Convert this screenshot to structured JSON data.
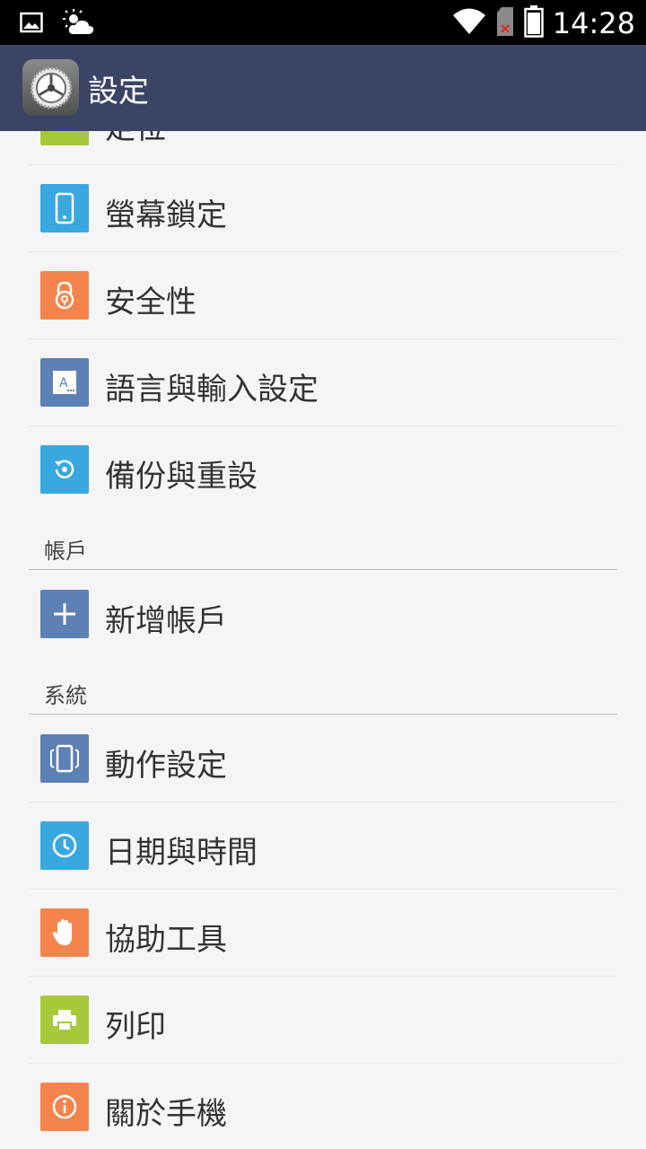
{
  "status_bar": {
    "time": "14:28",
    "icons": [
      "image-icon",
      "weather-icon",
      "wifi-icon",
      "sim-icon",
      "battery-icon"
    ]
  },
  "app_bar": {
    "title": "設定",
    "icon": "settings-gear-icon"
  },
  "list": {
    "partial_item": {
      "label": "定位",
      "icon": "location-icon",
      "color": "#a6c93a"
    },
    "items_top": [
      {
        "label": "螢幕鎖定",
        "icon": "phone-lock-icon",
        "color": "#3aa8e0"
      },
      {
        "label": "安全性",
        "icon": "padlock-icon",
        "color": "#f5844c"
      },
      {
        "label": "語言與輸入設定",
        "icon": "language-icon",
        "color": "#5d80b5"
      },
      {
        "label": "備份與重設",
        "icon": "backup-restore-icon",
        "color": "#3aa8e0"
      }
    ],
    "section_accounts": "帳戶",
    "items_accounts": [
      {
        "label": "新增帳戶",
        "icon": "plus-icon",
        "color": "#5d80b5"
      }
    ],
    "section_system": "系統",
    "items_system": [
      {
        "label": "動作設定",
        "icon": "motion-icon",
        "color": "#5d80b5"
      },
      {
        "label": "日期與時間",
        "icon": "clock-icon",
        "color": "#3aa8e0"
      },
      {
        "label": "協助工具",
        "icon": "hand-icon",
        "color": "#f5844c"
      },
      {
        "label": "列印",
        "icon": "printer-icon",
        "color": "#a6c93a"
      },
      {
        "label": "關於手機",
        "icon": "info-icon",
        "color": "#f5844c"
      }
    ]
  }
}
